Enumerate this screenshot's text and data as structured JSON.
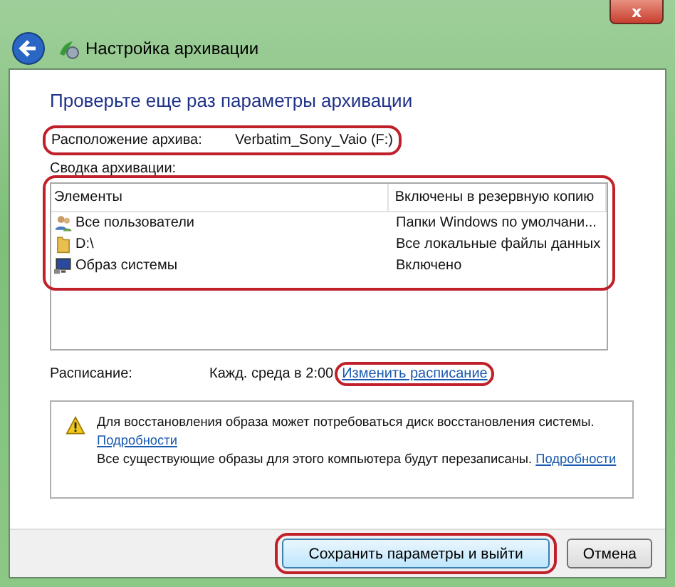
{
  "window": {
    "title": "Настройка архивации",
    "close": "x"
  },
  "heading": "Проверьте еще раз параметры архивации",
  "location": {
    "label": "Расположение архива:",
    "value": "Verbatim_Sony_Vaio (F:)",
    "circled": true
  },
  "summary": {
    "label": "Сводка архивации:",
    "circled": true,
    "table": {
      "columns": [
        "Элементы",
        "Включены в резервную копию"
      ],
      "rows": [
        {
          "kind": "users",
          "name": "Все пользователи",
          "included": "Папки Windows по умолчани..."
        },
        {
          "kind": "folder",
          "name": "D:\\",
          "included": "Все локальные файлы данных"
        },
        {
          "kind": "computer",
          "name": "Образ системы",
          "included": "Включено"
        }
      ]
    }
  },
  "schedule": {
    "label": "Расписание:",
    "value": "Кажд. среда в 2:00",
    "link": "Изменить расписание",
    "circled": true
  },
  "warning": {
    "line_1": "Для восстановления образа может потребоваться диск восстановления системы.",
    "link_1": "Подробности",
    "line_2": "Все существующие образы для этого компьютера будут перезаписаны.",
    "link_2": "Подробности"
  },
  "buttons": [
    {
      "label": "Сохранить параметры и выйти",
      "default": true,
      "circled": true
    },
    {
      "label": "Отмена",
      "default": false,
      "circled": false
    }
  ]
}
